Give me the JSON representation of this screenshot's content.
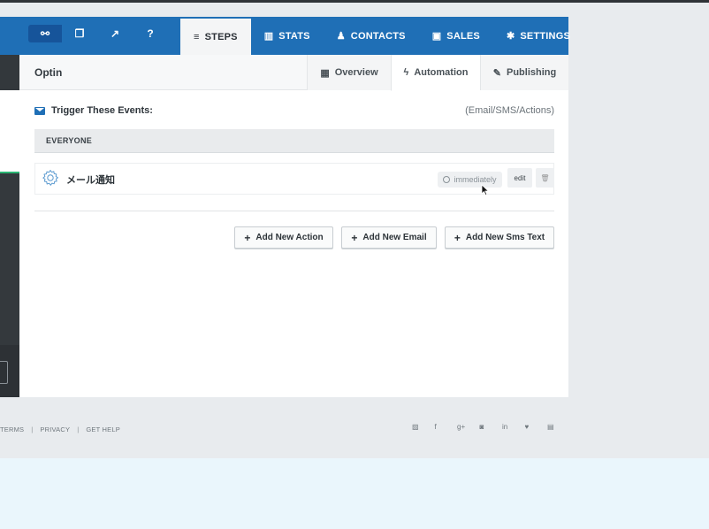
{
  "topbar": {
    "icons": [
      {
        "name": "link-icon",
        "glyph": "⚯"
      },
      {
        "name": "copy-icon",
        "glyph": "❐"
      },
      {
        "name": "external-link-icon",
        "glyph": "↗"
      },
      {
        "name": "help-icon",
        "glyph": "?"
      }
    ],
    "tabs": [
      {
        "label": "STEPS",
        "icon": "menu-icon",
        "glyph": "≡"
      },
      {
        "label": "STATS",
        "icon": "bar-chart-icon",
        "glyph": "▥"
      },
      {
        "label": "CONTACTS",
        "icon": "users-icon",
        "glyph": "♟"
      },
      {
        "label": "SALES",
        "icon": "money-icon",
        "glyph": "▣"
      },
      {
        "label": "SETTINGS",
        "icon": "gear-icon",
        "glyph": "✱"
      }
    ]
  },
  "card": {
    "title": "Optin",
    "subtabs": [
      {
        "label": "Overview",
        "icon": "grid-icon",
        "glyph": "▦"
      },
      {
        "label": "Automation",
        "icon": "bolt-icon",
        "glyph": "ϟ"
      },
      {
        "label": "Publishing",
        "icon": "wrench-icon",
        "glyph": "✎"
      }
    ],
    "trigger_title": "Trigger These Events:",
    "trigger_sub": "(Email/SMS/Actions)",
    "group_label": "EVERYONE",
    "action": {
      "name": "メール通知",
      "timing": "immediately",
      "edit_label": "edit",
      "delete_glyph": "🗑"
    },
    "buttons": {
      "add_action": "Add New Action",
      "add_email": "Add New Email",
      "add_sms": "Add New Sms Text"
    }
  },
  "footer": {
    "links": [
      "TERMS",
      "PRIVACY",
      "GET HELP"
    ],
    "social": [
      {
        "name": "blog-icon",
        "glyph": "▨"
      },
      {
        "name": "facebook-icon",
        "glyph": "f"
      },
      {
        "name": "google-plus-icon",
        "glyph": "g+"
      },
      {
        "name": "instagram-icon",
        "glyph": "◙"
      },
      {
        "name": "linkedin-icon",
        "glyph": "in"
      },
      {
        "name": "twitter-icon",
        "glyph": "♥"
      },
      {
        "name": "youtube-icon",
        "glyph": "▤"
      }
    ]
  },
  "colors": {
    "topbar": "#1f6fb6",
    "accent_green": "#2bb673",
    "page_bg": "#e8ebee"
  }
}
